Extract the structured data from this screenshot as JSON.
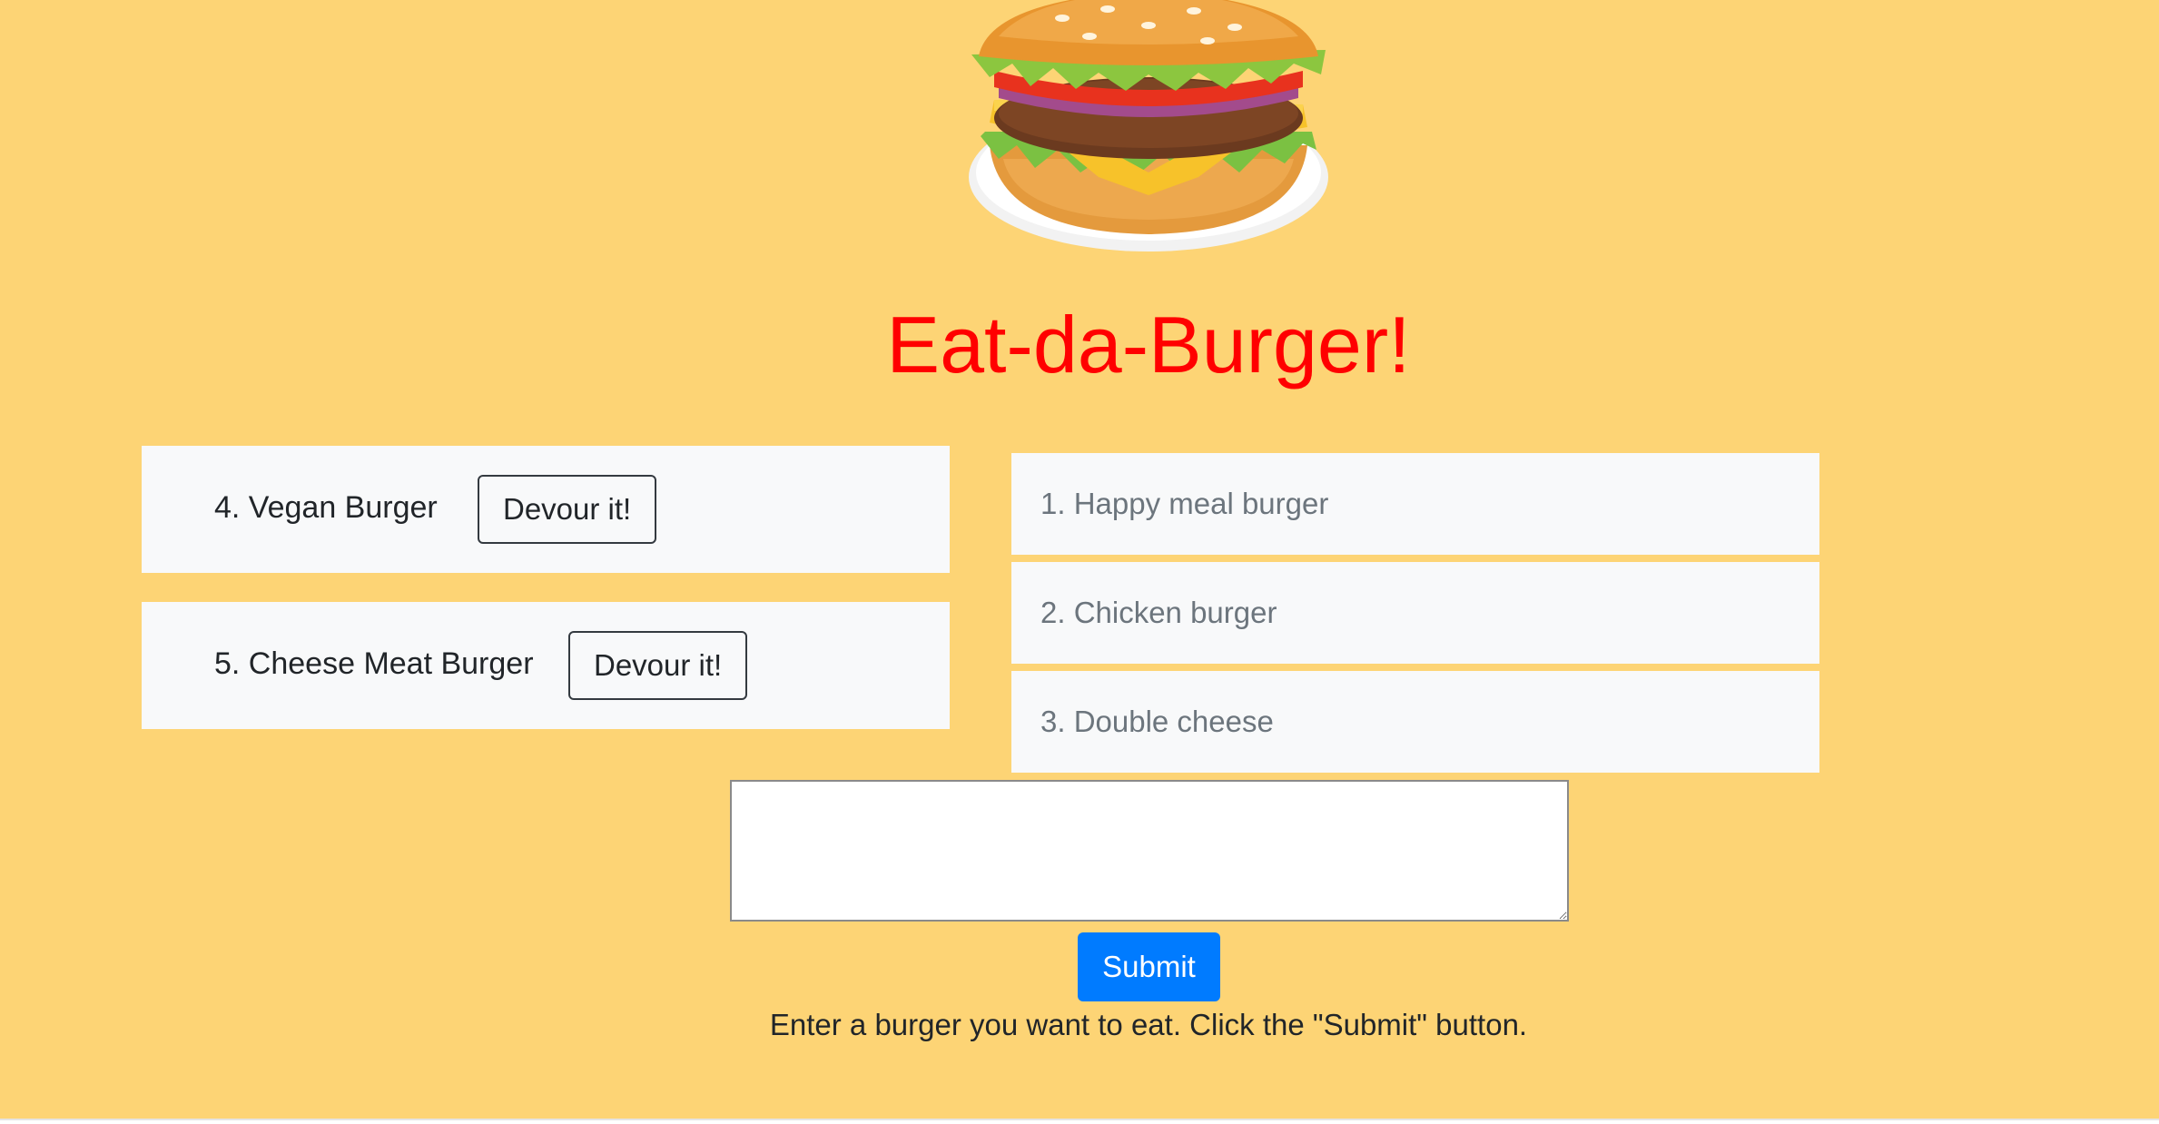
{
  "header": {
    "title": "Eat-da-Burger!",
    "logo_icon": "burger-icon"
  },
  "uneaten_burgers": [
    {
      "label": "4. Vegan Burger",
      "button_label": "Devour it!"
    },
    {
      "label": "5. Cheese Meat Burger",
      "button_label": "Devour it!"
    }
  ],
  "devoured_burgers": [
    {
      "label": "1. Happy meal burger"
    },
    {
      "label": "2. Chicken burger"
    },
    {
      "label": "3. Double cheese"
    }
  ],
  "form": {
    "input_value": "",
    "submit_label": "Submit",
    "instructions": "Enter a burger you want to eat. Click the \"Submit\" button."
  },
  "colors": {
    "background": "#fdd475",
    "title": "#ff0000",
    "card": "#f8f9fa",
    "submit": "#007bff"
  }
}
